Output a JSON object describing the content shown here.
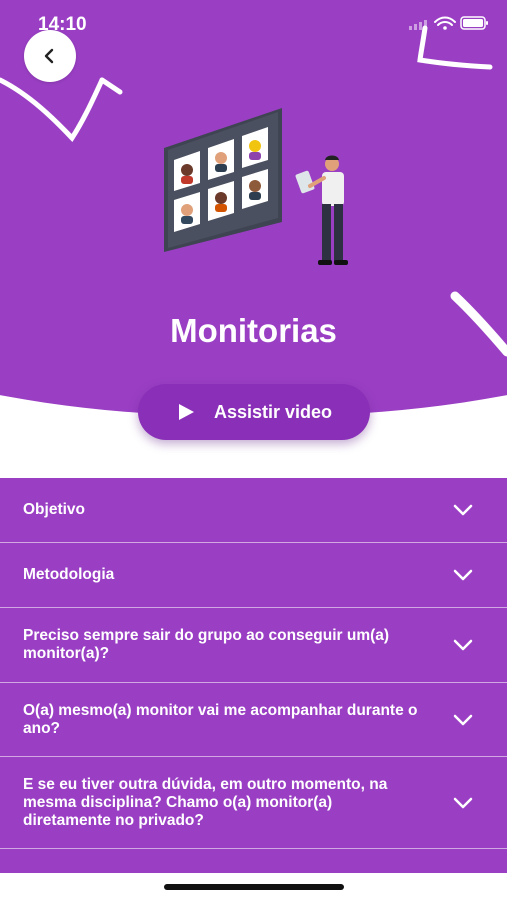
{
  "status_bar": {
    "time": "14:10"
  },
  "page": {
    "title": "Monitorias"
  },
  "video_button": {
    "label": "Assistir video"
  },
  "faq": [
    {
      "label": "Objetivo"
    },
    {
      "label": "Metodologia"
    },
    {
      "label": "Preciso sempre sair do grupo ao conseguir um(a) monitor(a)?"
    },
    {
      "label": "O(a) mesmo(a) monitor vai me acompanhar durante o ano?"
    },
    {
      "label": "E se eu tiver outra dúvida, em outro momento, na mesma disciplina? Chamo o(a) monitor(a) diretamente no privado?"
    }
  ],
  "colors": {
    "primary": "#9a3fc4",
    "button": "#8a2fb8",
    "text": "#ffffff"
  },
  "icons": [
    "back-arrow-icon",
    "signal-icon",
    "wifi-icon",
    "battery-icon",
    "play-icon",
    "chevron-down-icon"
  ]
}
